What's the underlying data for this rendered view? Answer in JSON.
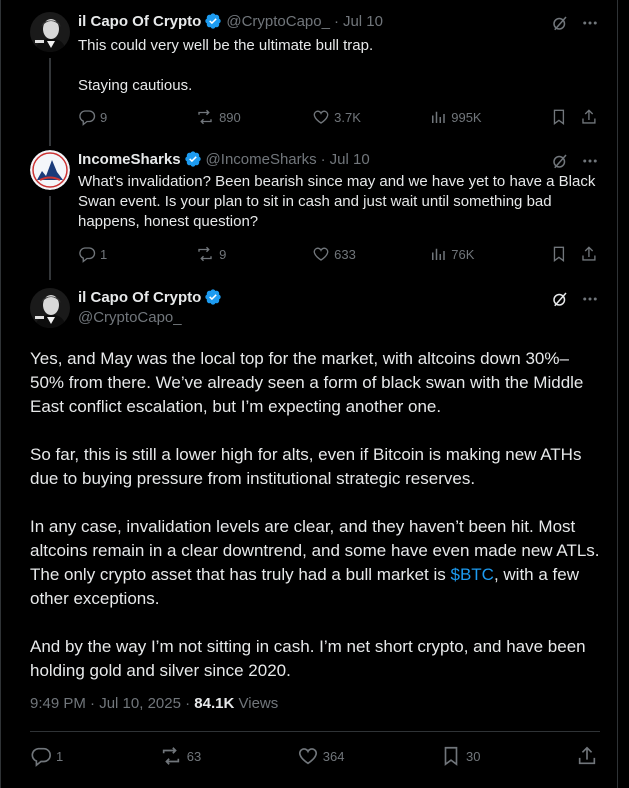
{
  "tweet1": {
    "name": "il Capo Of Crypto",
    "handle": "@CryptoCapo_",
    "date": "Jul 10",
    "text": "This could very well be the ultimate bull trap.\n\nStaying cautious.",
    "replies": "9",
    "retweets": "890",
    "likes": "3.7K",
    "views": "995K"
  },
  "tweet2": {
    "name": "IncomeSharks",
    "handle": "@IncomeSharks",
    "date": "Jul 10",
    "text": "What's invalidation? Been bearish since may and we have yet to have a Black Swan event. Is your plan to sit in cash and just wait until something bad happens, honest question?",
    "replies": "1",
    "retweets": "9",
    "likes": "633",
    "views": "76K"
  },
  "main": {
    "name": "il Capo Of Crypto",
    "handle": "@CryptoCapo_",
    "para1": "Yes, and May was the local top for the market, with altcoins down 30%–50% from there. We’ve already seen a form of black swan with the Middle East conflict escalation, but I’m expecting another one.",
    "para2": "So far, this is still a lower high for alts, even if Bitcoin is making new ATHs due to buying pressure from institutional strategic reserves.",
    "para3_before": "In any case, invalidation levels are clear, and they haven’t been hit. Most altcoins remain in a clear downtrend, and some have even made new ATLs. The only crypto asset that has truly had a bull market is ",
    "cashtag": "$BTC",
    "para3_after": ", with a few other exceptions.",
    "para4": "And by the way I’m not sitting in cash. I’m net short crypto, and have been holding gold and silver since 2020.",
    "time": "9:49 PM",
    "sep": "·",
    "date": "Jul 10, 2025",
    "views_count": "84.1K",
    "views_label": "Views",
    "replies": "1",
    "retweets": "63",
    "likes": "364",
    "bookmarks": "30"
  },
  "colors": {
    "background": "#000000",
    "text": "#e7e9ea",
    "secondary": "#71767b",
    "accent": "#1d9bf0",
    "verified": "#1d9bf0"
  }
}
